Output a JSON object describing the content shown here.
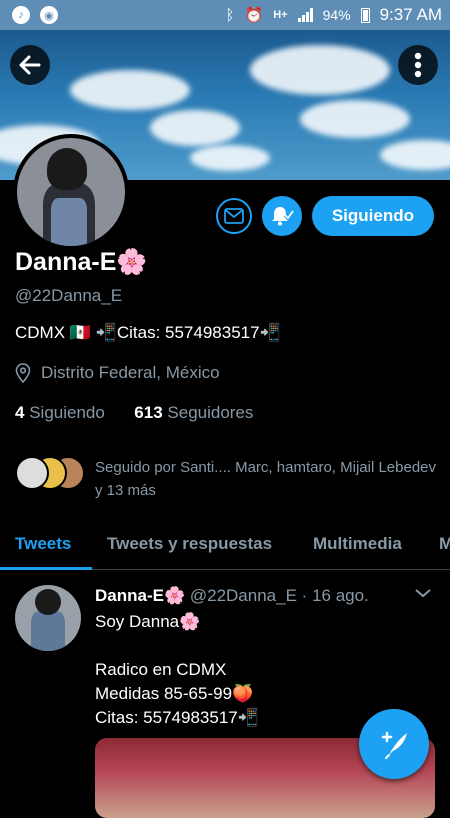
{
  "status_bar": {
    "time": "9:37 AM",
    "battery": "94%",
    "network": "H+",
    "icons": [
      "music-note-icon",
      "maps-icon",
      "bluetooth-icon",
      "alarm-icon",
      "signal-icon",
      "battery-icon"
    ]
  },
  "header": {
    "back_icon": "arrow-left-icon",
    "menu_icon": "more-vertical-icon"
  },
  "profile": {
    "name": "Danna-E🌸",
    "handle": "@22Danna_E",
    "bio": "CDMX 🇲🇽 📲Citas: 5574983517📲",
    "location": "Distrito Federal, México",
    "following_count": "4",
    "following_label": "Siguiendo",
    "followers_count": "613",
    "followers_label": "Seguidores",
    "followed_by": "Seguido por Santi.... Marc, hamtaro, Mijail Lebedev y 13 más",
    "follow_button_label": "Siguiendo"
  },
  "tabs": [
    {
      "label": "Tweets",
      "active": true
    },
    {
      "label": "Tweets y respuestas",
      "active": false
    },
    {
      "label": "Multimedia",
      "active": false
    },
    {
      "label": "M",
      "active": false
    }
  ],
  "tweet": {
    "name": "Danna-E🌸",
    "handle": "@22Danna_E",
    "separator": "·",
    "date": "16 ago.",
    "lines": [
      "Soy Danna🌸",
      "",
      "Radico en CDMX",
      "Medidas 85-65-99🍑",
      "Citas: 5574983517📲"
    ]
  },
  "colors": {
    "accent": "#1da1f2",
    "muted": "#8899a6",
    "background": "#000000",
    "status_bar": "#5e8db5"
  }
}
